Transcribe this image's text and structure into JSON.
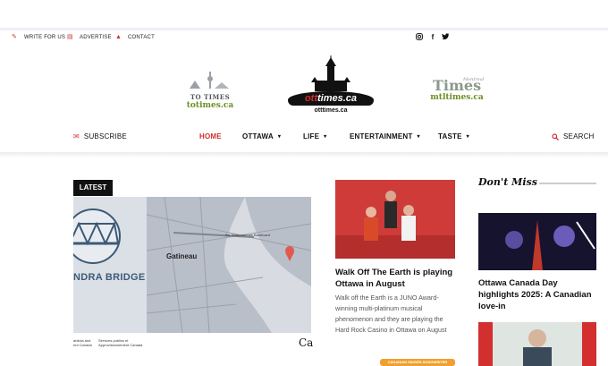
{
  "utility": {
    "write_label": "WRITE FOR US",
    "advertise_label": "ADVERTISE",
    "contact_label": "CONTACT"
  },
  "social": [
    "instagram-icon",
    "facebook-icon",
    "twitter-icon"
  ],
  "logos": {
    "left_title": "TO TIMES",
    "left_domain": "totimes.ca",
    "center_wordmark_pre": "ott",
    "center_wordmark_post": "times.ca",
    "center_domain": "otttimes.ca",
    "right_title": "Times",
    "right_sub": "Montreal",
    "right_domain": "mtltimes.ca"
  },
  "nav": {
    "subscribe": "SUBSCRIBE",
    "items": [
      {
        "label": "HOME",
        "active": true
      },
      {
        "label": "OTTAWA",
        "caret": "▾"
      },
      {
        "label": "LIFE",
        "caret": "▾"
      },
      {
        "label": "ENTERTAINMENT",
        "caret": "▾"
      },
      {
        "label": "TASTE",
        "caret": "▾"
      }
    ],
    "search": "SEARCH"
  },
  "latest": {
    "tag": "LATEST",
    "map_bridge_text": "NDRA BRIDGE",
    "map_place": "Gatineau",
    "map_road": "Bd. Maisonneuve Boulevard",
    "foot_left_1": "anticia and",
    "foot_left_2": "ent Canada",
    "foot_mid_1": "Services publics et",
    "foot_mid_2": "Approvisionnement Canada",
    "foot_right": "Ca"
  },
  "article": {
    "title": "Walk Off The Earth is playing Ottawa in August",
    "excerpt": "Walk off the Earth is a JUNO Award-winning multi-platinum musical phenomenon and they are playing the Hard Rock Casino in Ottawa on August",
    "bottom_tag": "CANADIAN SINGER-SONGWRITER"
  },
  "sidebar": {
    "title": "Don't Miss",
    "story_title": "Ottawa Canada Day highlights 2025: A Canadian love-in"
  },
  "colors": {
    "accent": "#d32f2f",
    "dark": "#111111"
  }
}
